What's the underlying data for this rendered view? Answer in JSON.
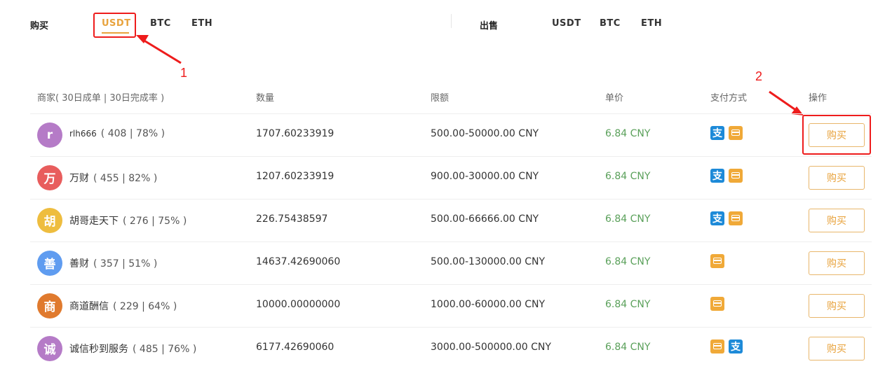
{
  "tabs": {
    "buy_label": "购买",
    "sell_label": "出售",
    "buy_coins": [
      "USDT",
      "BTC",
      "ETH"
    ],
    "sell_coins": [
      "USDT",
      "BTC",
      "ETH"
    ],
    "active_buy": "USDT"
  },
  "annotations": [
    "1",
    "2"
  ],
  "table": {
    "headers": {
      "merchant": "商家( 30日成单 | 30日完成率 )",
      "quantity": "数量",
      "limit": "限额",
      "price": "单价",
      "payment": "支付方式",
      "action": "操作"
    },
    "rows": [
      {
        "avatar": "r",
        "avatar_color": "#b57bc7",
        "name": "rlh666",
        "stats": "( 408 | 78% )",
        "quantity": "1707.60233919",
        "limit": "500.00-50000.00 CNY",
        "price": "6.84 CNY",
        "payments": [
          "alipay-icon",
          "bank-card-icon"
        ],
        "action": "购买"
      },
      {
        "avatar": "万",
        "avatar_color": "#e85d5d",
        "name": "万财",
        "stats": "( 455 | 82% )",
        "quantity": "1207.60233919",
        "limit": "900.00-30000.00 CNY",
        "price": "6.84 CNY",
        "payments": [
          "alipay-icon",
          "bank-card-icon"
        ],
        "action": "购买"
      },
      {
        "avatar": "胡",
        "avatar_color": "#eebd3f",
        "name": "胡哥走天下",
        "stats": "( 276 | 75% )",
        "quantity": "226.75438597",
        "limit": "500.00-66666.00 CNY",
        "price": "6.84 CNY",
        "payments": [
          "alipay-icon",
          "bank-card-icon"
        ],
        "action": "购买"
      },
      {
        "avatar": "善",
        "avatar_color": "#5f9cf0",
        "name": "善财",
        "stats": "( 357 | 51% )",
        "quantity": "14637.42690060",
        "limit": "500.00-130000.00 CNY",
        "price": "6.84 CNY",
        "payments": [
          "bank-card-icon"
        ],
        "action": "购买"
      },
      {
        "avatar": "商",
        "avatar_color": "#e07a2e",
        "name": "商道酬信",
        "stats": "( 229 | 64% )",
        "quantity": "10000.00000000",
        "limit": "1000.00-60000.00 CNY",
        "price": "6.84 CNY",
        "payments": [
          "bank-card-icon"
        ],
        "action": "购买"
      },
      {
        "avatar": "诚",
        "avatar_color": "#b57bc7",
        "name": "诚信秒到服务",
        "stats": "( 485 | 76% )",
        "quantity": "6177.42690060",
        "limit": "3000.00-500000.00 CNY",
        "price": "6.84 CNY",
        "payments": [
          "bank-card-icon",
          "alipay-icon"
        ],
        "action": "购买"
      }
    ]
  },
  "colors": {
    "accent": "#e8a33d",
    "price_green": "#5aa05a",
    "annotation_red": "#ee1c1c",
    "alipay_blue": "#1d8ad8",
    "card_orange": "#f0a938"
  }
}
